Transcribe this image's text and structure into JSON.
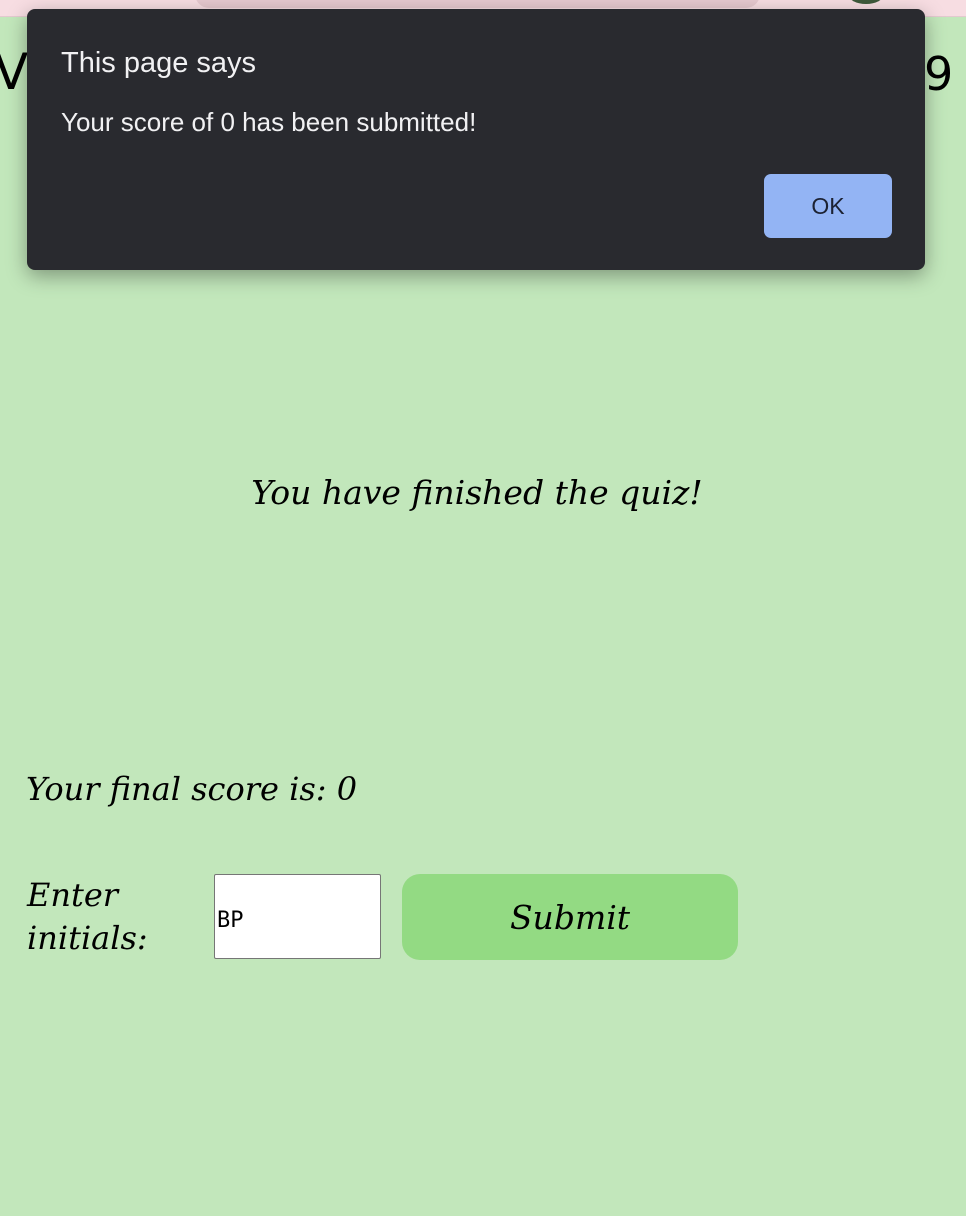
{
  "header": {
    "left_text": "V",
    "right_text": "9"
  },
  "quiz": {
    "finished_message": "You have finished the quiz!",
    "final_score_label": "Your final score is: 0",
    "initials_label": "Enter initials:",
    "initials_value": "BP",
    "submit_label": "Submit"
  },
  "dialog": {
    "title": "This page says",
    "message": "Your score of 0 has been submitted!",
    "ok_label": "OK"
  },
  "colors": {
    "page_background": "#c2e7bb",
    "submit_button": "#93da83",
    "dialog_background": "#292a2f",
    "ok_button": "#93b4f4"
  }
}
